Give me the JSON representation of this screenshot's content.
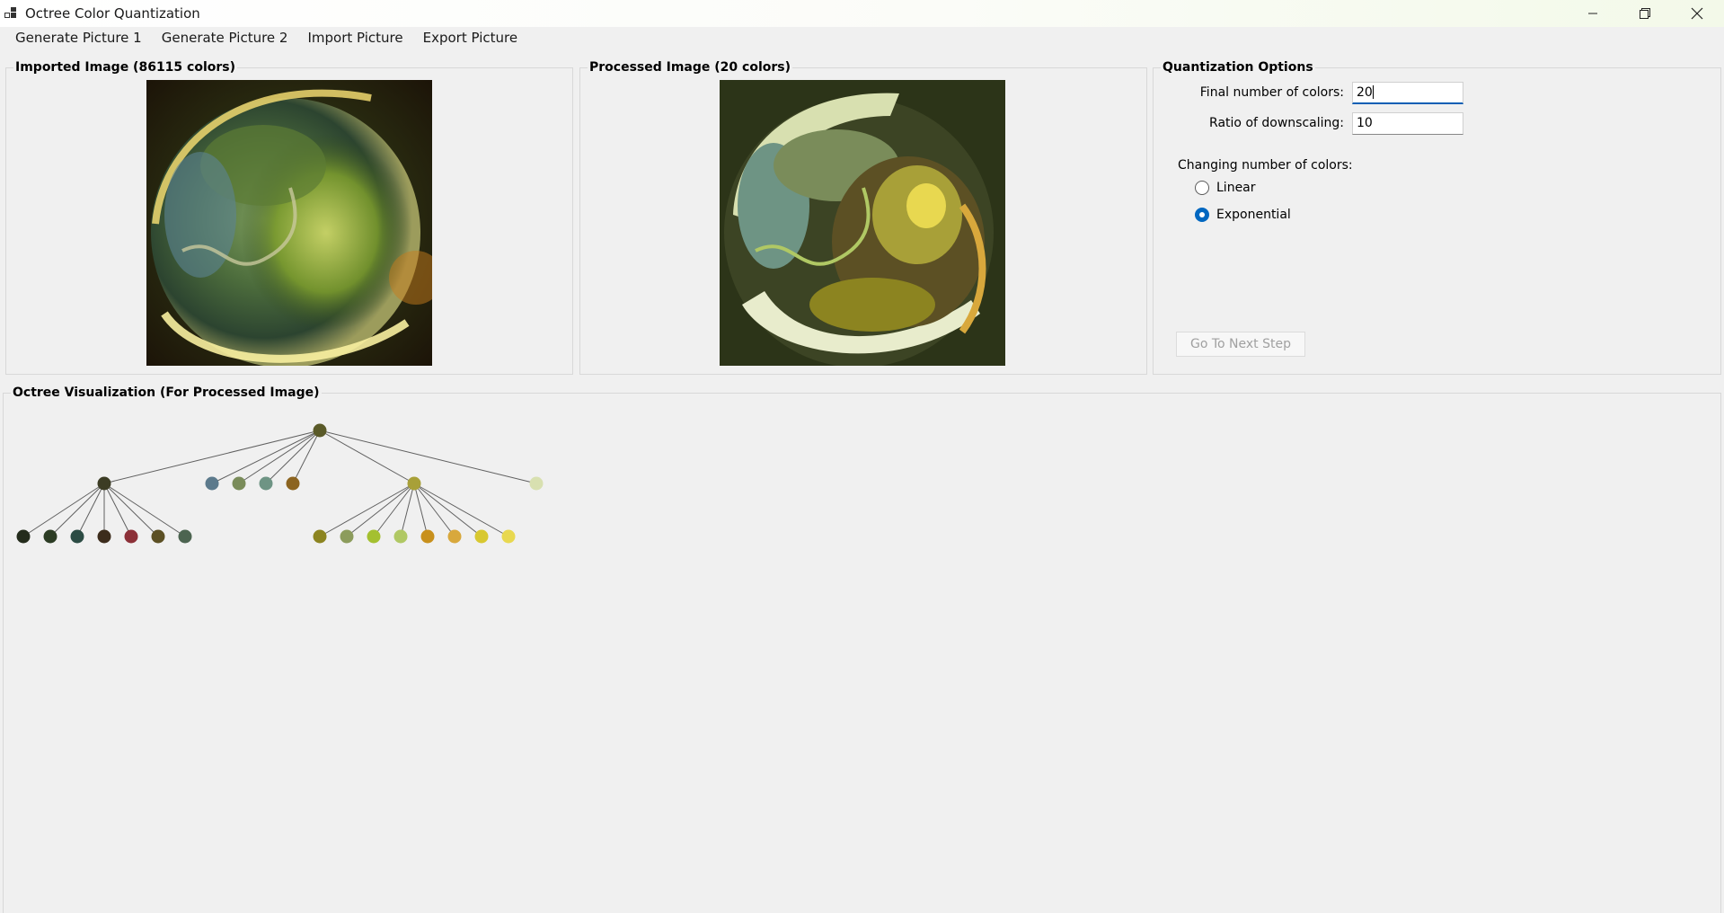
{
  "window": {
    "title": "Octree Color Quantization"
  },
  "menu": [
    "Generate Picture 1",
    "Generate Picture 2",
    "Import Picture",
    "Export Picture"
  ],
  "imported": {
    "title": "Imported Image (86115 colors)"
  },
  "processed": {
    "title": "Processed Image (20 colors)"
  },
  "options": {
    "title": "Quantization Options",
    "final_colors_label": "Final number of colors:",
    "final_colors_value": "20",
    "ratio_label": "Ratio of downscaling:",
    "ratio_value": "10",
    "changing_label": "Changing number of colors:",
    "radio_linear": "Linear",
    "radio_exponential": "Exponential",
    "selected": "Exponential",
    "next_step_button": "Go To Next Step"
  },
  "octree": {
    "title": "Octree Visualization (For Processed Image)",
    "root_color": "#5a5a28",
    "level1": [
      "#3c3c24",
      "#5c7a8c",
      "#7a8c5a",
      "#6e9484",
      "#8c6420",
      "#a8a038",
      "#d8e0b0"
    ],
    "children_of_first": [
      "#242c1c",
      "#2c3c24",
      "#2c4c44",
      "#3c2c1c",
      "#8c3038",
      "#5c5024",
      "#4c6450"
    ],
    "children_of_sixth": [
      "#8c8420",
      "#8c9c5c",
      "#a4c030",
      "#b0c864",
      "#c8901c",
      "#d8a83c",
      "#d8c830",
      "#e8d850"
    ]
  },
  "colors": {
    "accent": "#0067c0",
    "background": "#f0f0f0"
  }
}
